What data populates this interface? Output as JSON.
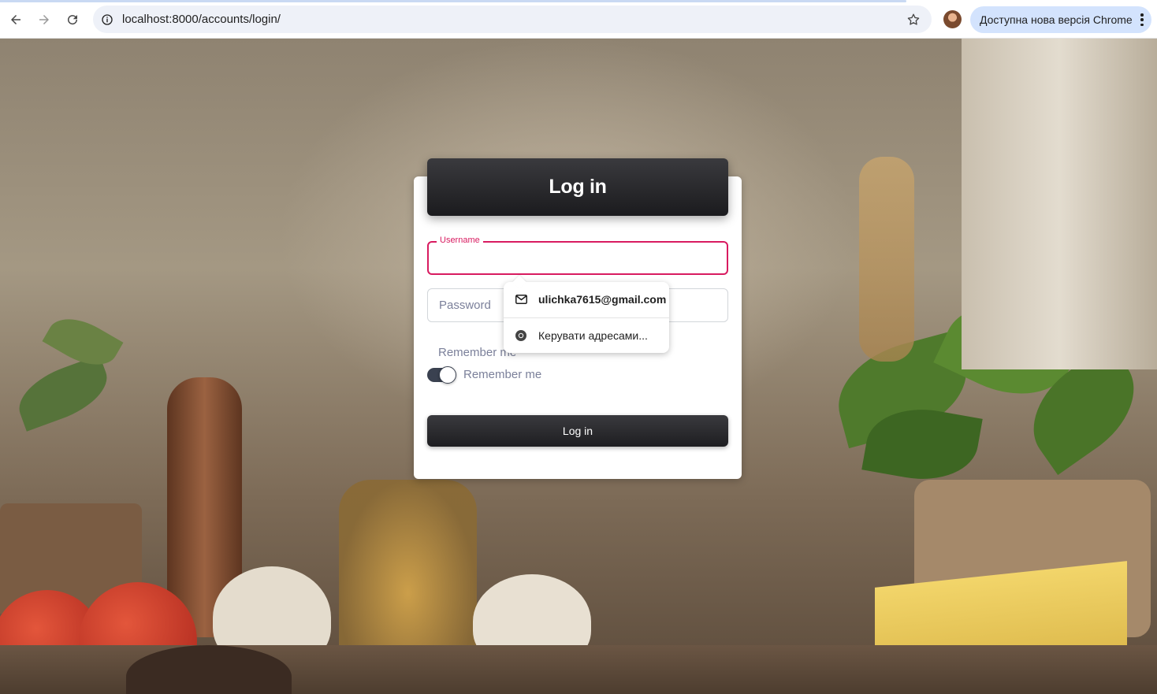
{
  "browser": {
    "url": "localhost:8000/accounts/login/",
    "update_label": "Доступна нова версія Chrome"
  },
  "login_card": {
    "title": "Log in",
    "username_label": "Username",
    "username_value": "",
    "password_placeholder": "Password",
    "remember_label_top": "Remember me",
    "remember_label": "Remember me",
    "remember_checked": true,
    "submit_label": "Log in"
  },
  "autofill": {
    "suggestion": "ulichka7615@gmail.com",
    "manage_label": "Керувати адресами..."
  },
  "colors": {
    "accent": "#d81b60",
    "button_dark": "#1e1e21",
    "chrome_pill": "#d3e3fd"
  },
  "icons": {
    "back": "arrow-left-icon",
    "forward": "arrow-right-icon",
    "reload": "reload-icon",
    "site_info": "info-icon",
    "bookmark": "star-icon",
    "menu": "kebab-icon",
    "suggestion": "mail-icon",
    "manage": "chrome-icon"
  }
}
